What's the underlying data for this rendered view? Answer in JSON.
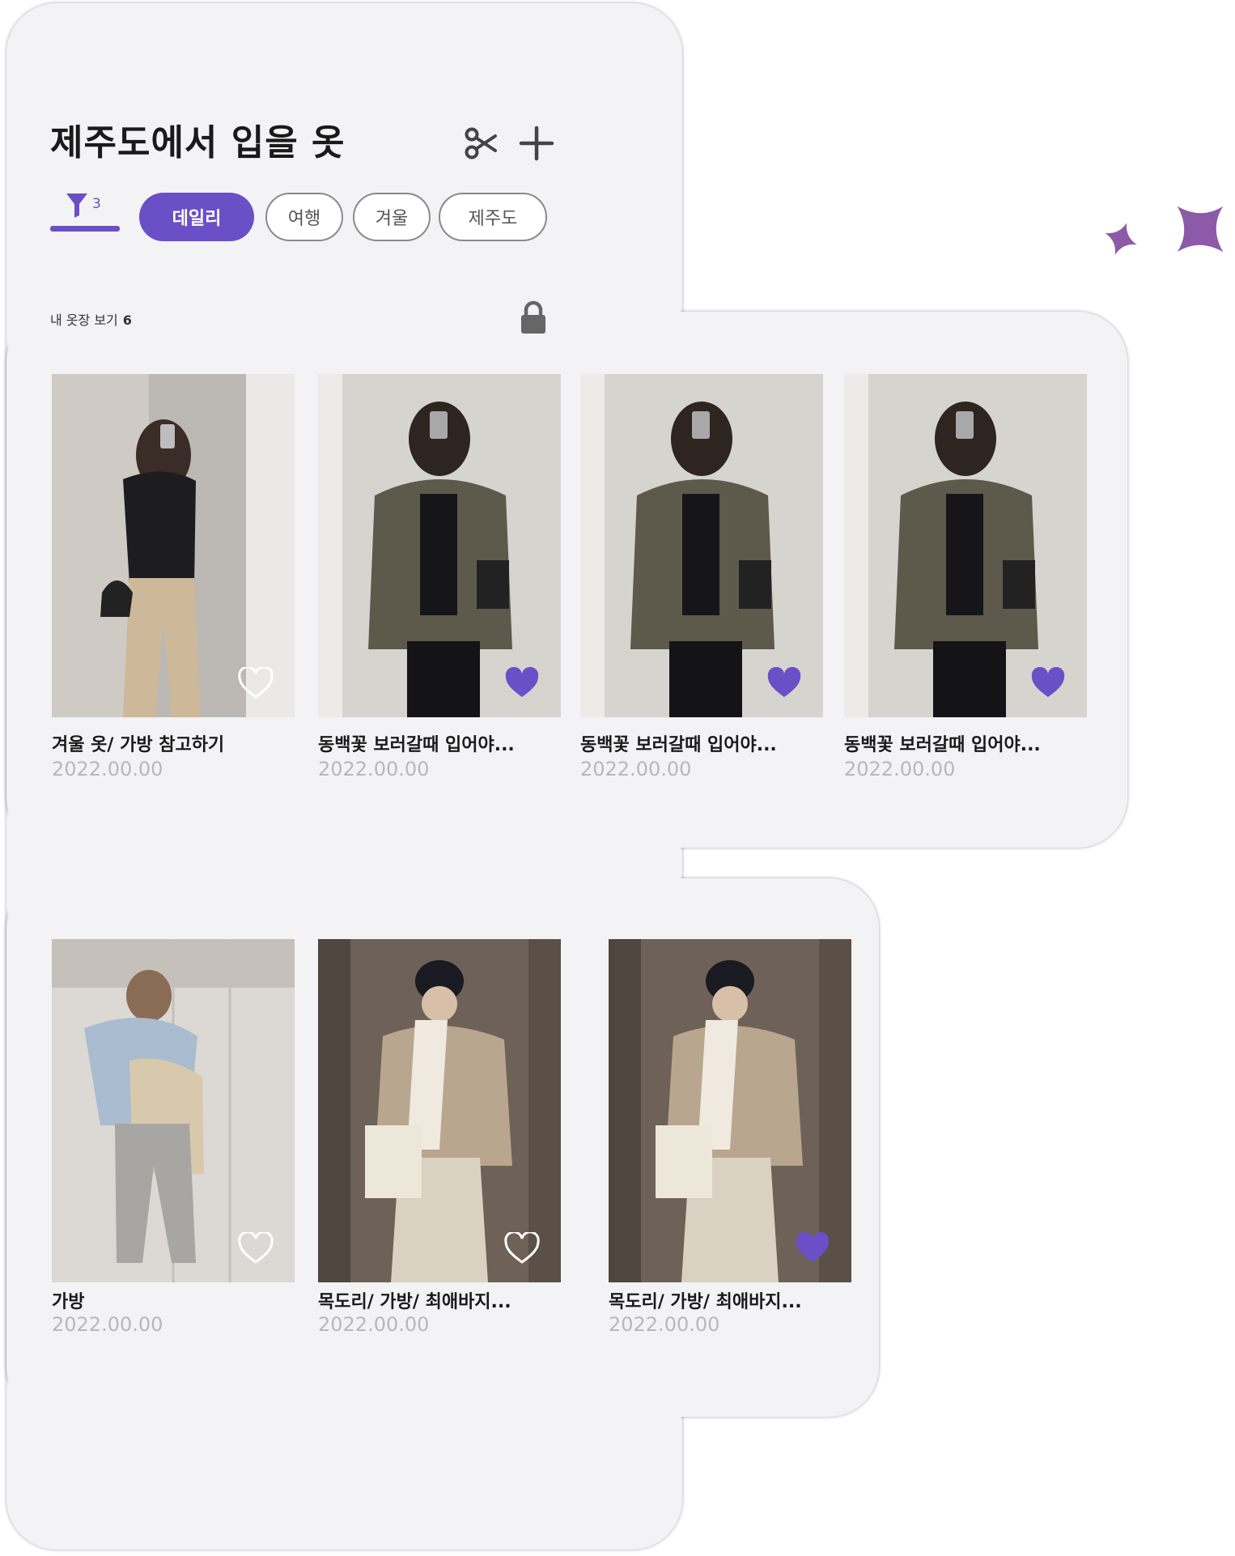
{
  "header": {
    "title": "제주도에서 입을 옷"
  },
  "toolbar": {
    "scissors_icon": "scissors-icon",
    "add_icon": "plus-icon"
  },
  "filter": {
    "count": "3",
    "icon": "funnel-icon"
  },
  "chips": [
    {
      "label": "데일리",
      "active": true
    },
    {
      "label": "여행",
      "active": false
    },
    {
      "label": "겨울",
      "active": false
    },
    {
      "label": "제주도",
      "active": false
    }
  ],
  "section": {
    "label": "내 옷장 보기",
    "count": "6",
    "lock_icon": "lock-icon"
  },
  "accent": "#6b4fc7",
  "items": [
    {
      "title": "겨울 옷/ 가방 참고하기",
      "date": "2022.00.00",
      "liked": false
    },
    {
      "title": "동백꽃 보러갈때 입어야...",
      "date": "2022.00.00",
      "liked": true
    },
    {
      "title": "동백꽃 보러갈때 입어야...",
      "date": "2022.00.00",
      "liked": true
    },
    {
      "title": "동백꽃 보러갈때 입어야...",
      "date": "2022.00.00",
      "liked": true
    },
    {
      "title": "가방",
      "date": "2022.00.00",
      "liked": false
    },
    {
      "title": "목도리/ 가방/ 최애바지...",
      "date": "2022.00.00",
      "liked": false
    },
    {
      "title": "목도리/ 가방/ 최애바지...",
      "date": "2022.00.00",
      "liked": true
    }
  ]
}
